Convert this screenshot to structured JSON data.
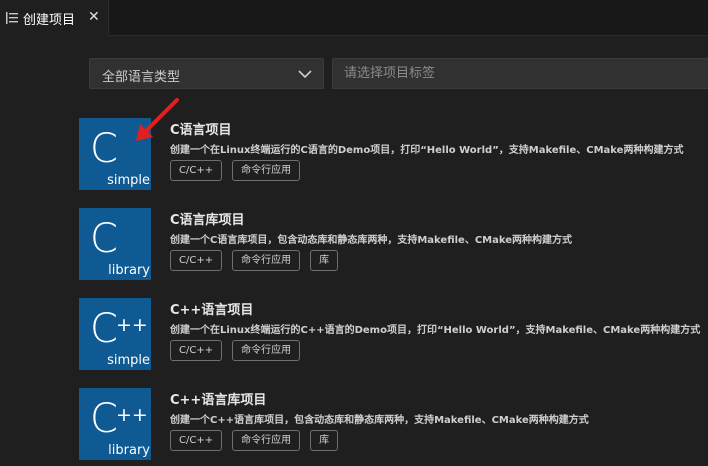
{
  "tab": {
    "label": "创建项目",
    "icon": "preview-icon",
    "close": "✕"
  },
  "filters": {
    "language_select": {
      "value": "全部语言类型",
      "icon": "chevron-down-icon"
    },
    "tag_input": {
      "placeholder": "请选择项目标签"
    }
  },
  "colors": {
    "accent_thumb": "#0f5a93",
    "annotation_arrow": "#e02020",
    "background": "#1f1f1f"
  },
  "projects": [
    {
      "thumb_letter": "C",
      "thumb_plus": "",
      "thumb_sub": "simple",
      "title": "C语言项目",
      "description": "创建一个在Linux终端运行的C语言的Demo项目，打印“Hello World”，支持Makefile、CMake两种构建方式",
      "tags": [
        "C/C++",
        "命令行应用"
      ]
    },
    {
      "thumb_letter": "C",
      "thumb_plus": "",
      "thumb_sub": "library",
      "title": "C语言库项目",
      "description": "创建一个C语言库项目，包含动态库和静态库两种，支持Makefile、CMake两种构建方式",
      "tags": [
        "C/C++",
        "命令行应用",
        "库"
      ]
    },
    {
      "thumb_letter": "C",
      "thumb_plus": "++",
      "thumb_sub": "simple",
      "title": "C++语言项目",
      "description": "创建一个在Linux终端运行的C++语言的Demo项目，打印“Hello World”，支持Makefile、CMake两种构建方式",
      "tags": [
        "C/C++",
        "命令行应用"
      ]
    },
    {
      "thumb_letter": "C",
      "thumb_plus": "++",
      "thumb_sub": "library",
      "title": "C++语言库项目",
      "description": "创建一个C++语言库项目，包含动态库和静态库两种，支持Makefile、CMake两种构建方式",
      "tags": [
        "C/C++",
        "命令行应用",
        "库"
      ]
    }
  ]
}
